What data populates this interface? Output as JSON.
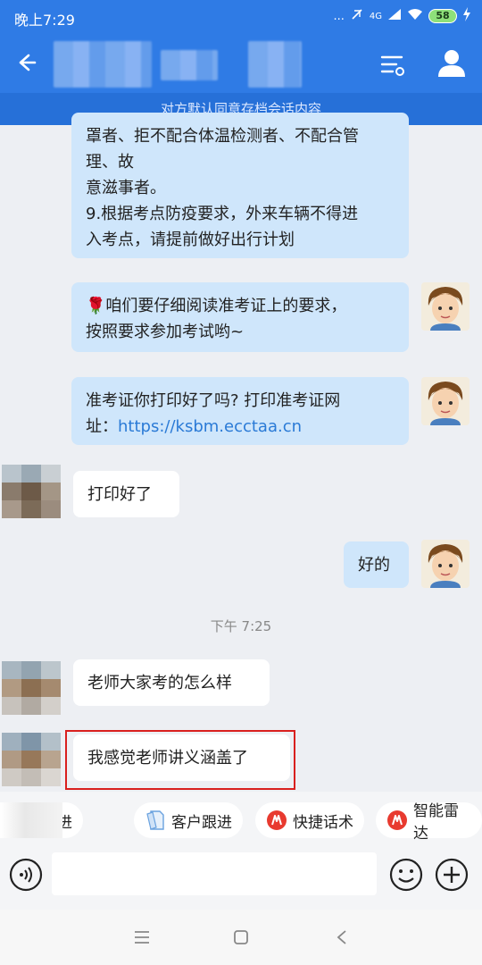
{
  "status_bar": {
    "time": "晚上7:29",
    "dots": "...",
    "network": "4G",
    "battery": "58"
  },
  "header": {
    "notice": "对方默认同意存档会话内容"
  },
  "messages": [
    {
      "side": "right",
      "lines": [
        "罩者、拒不配合体温检测者、不配合管",
        "理、故",
        "意滋事者。",
        "9.根据考点防疫要求，外来车辆不得进",
        "入考点，请提前做好出行计划"
      ]
    },
    {
      "side": "right",
      "emoji": "🌹",
      "lines": [
        "咱们要仔细阅读准考证上的要求，",
        "按照要求参加考试哟~"
      ]
    },
    {
      "side": "right",
      "line1": "准考证你打印好了吗? 打印准考证网",
      "line2_prefix": "址：",
      "link": "https://ksbm.ecctaa.cn"
    },
    {
      "side": "left",
      "text": "打印好了"
    },
    {
      "side": "right",
      "text": "好的"
    },
    {
      "side": "left",
      "text": "老师大家考的怎么样"
    },
    {
      "side": "left",
      "text": "我感觉老师讲义涵盖了"
    }
  ],
  "timestamp": "下午 7:25",
  "quick_tools": [
    {
      "label": "客户跟进",
      "icon": "partial-chip"
    },
    {
      "label": "客户跟进",
      "icon": "document-icon"
    },
    {
      "label": "快捷话术",
      "icon": "lightning-icon"
    },
    {
      "label": "智能雷达",
      "icon": "lightning-icon"
    }
  ],
  "quick_tool_partial_label": "户跟进",
  "colors": {
    "header": "#2f7be5",
    "bubble_right": "#cfe6fb",
    "bubble_left": "#ffffff",
    "highlight": "#d9201e",
    "link": "#2a7ad6"
  }
}
